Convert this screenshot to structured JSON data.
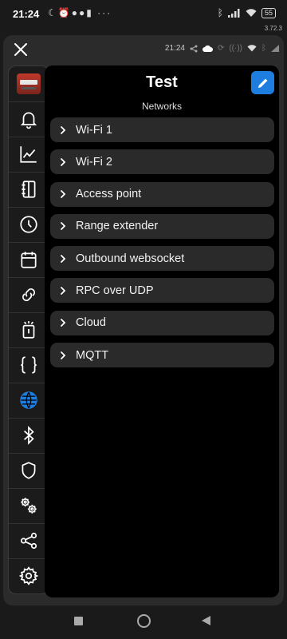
{
  "status_bar": {
    "time": "21:24",
    "left_icons": [
      "moon-icon",
      "alarm-icon",
      "chat-icon",
      "chat-icon",
      "clipboard-icon",
      "more-icon"
    ],
    "right_icons": [
      "bluetooth-icon",
      "signal-icon",
      "wifi-icon"
    ],
    "battery": "55",
    "version": "3.72.3"
  },
  "app_bar": {
    "close_icon": "close-icon",
    "device_time": "21:24",
    "device_icons": [
      "share-icon",
      "cloud-icon",
      "refresh-icon",
      "broadcast-icon",
      "wifi-icon",
      "bluetooth-icon",
      "signal-icon"
    ]
  },
  "sidebar": {
    "items": [
      {
        "icon": "device-avatar",
        "active": false
      },
      {
        "icon": "bell-icon",
        "active": false
      },
      {
        "icon": "chart-icon",
        "active": false
      },
      {
        "icon": "notebook-icon",
        "active": false
      },
      {
        "icon": "clock-icon",
        "active": false
      },
      {
        "icon": "calendar-icon",
        "active": false
      },
      {
        "icon": "link-icon",
        "active": false
      },
      {
        "icon": "input-icon",
        "active": false
      },
      {
        "icon": "braces-icon",
        "active": false
      },
      {
        "icon": "globe-icon",
        "active": true
      },
      {
        "icon": "bluetooth-icon",
        "active": false
      },
      {
        "icon": "shield-icon",
        "active": false
      },
      {
        "icon": "gears-icon",
        "active": false
      },
      {
        "icon": "share-icon",
        "active": false
      },
      {
        "icon": "settings-icon",
        "active": false
      }
    ],
    "accent": "#1e7ee0"
  },
  "main": {
    "title": "Test",
    "subtitle": "Networks",
    "edit_icon": "pencil-icon",
    "networks": [
      {
        "label": "Wi-Fi 1"
      },
      {
        "label": "Wi-Fi 2"
      },
      {
        "label": "Access point"
      },
      {
        "label": "Range extender"
      },
      {
        "label": "Outbound websocket"
      },
      {
        "label": "RPC over UDP"
      },
      {
        "label": "Cloud"
      },
      {
        "label": "MQTT"
      }
    ]
  },
  "nav_bar": {
    "buttons": [
      "recents-button",
      "home-button",
      "back-button"
    ]
  }
}
